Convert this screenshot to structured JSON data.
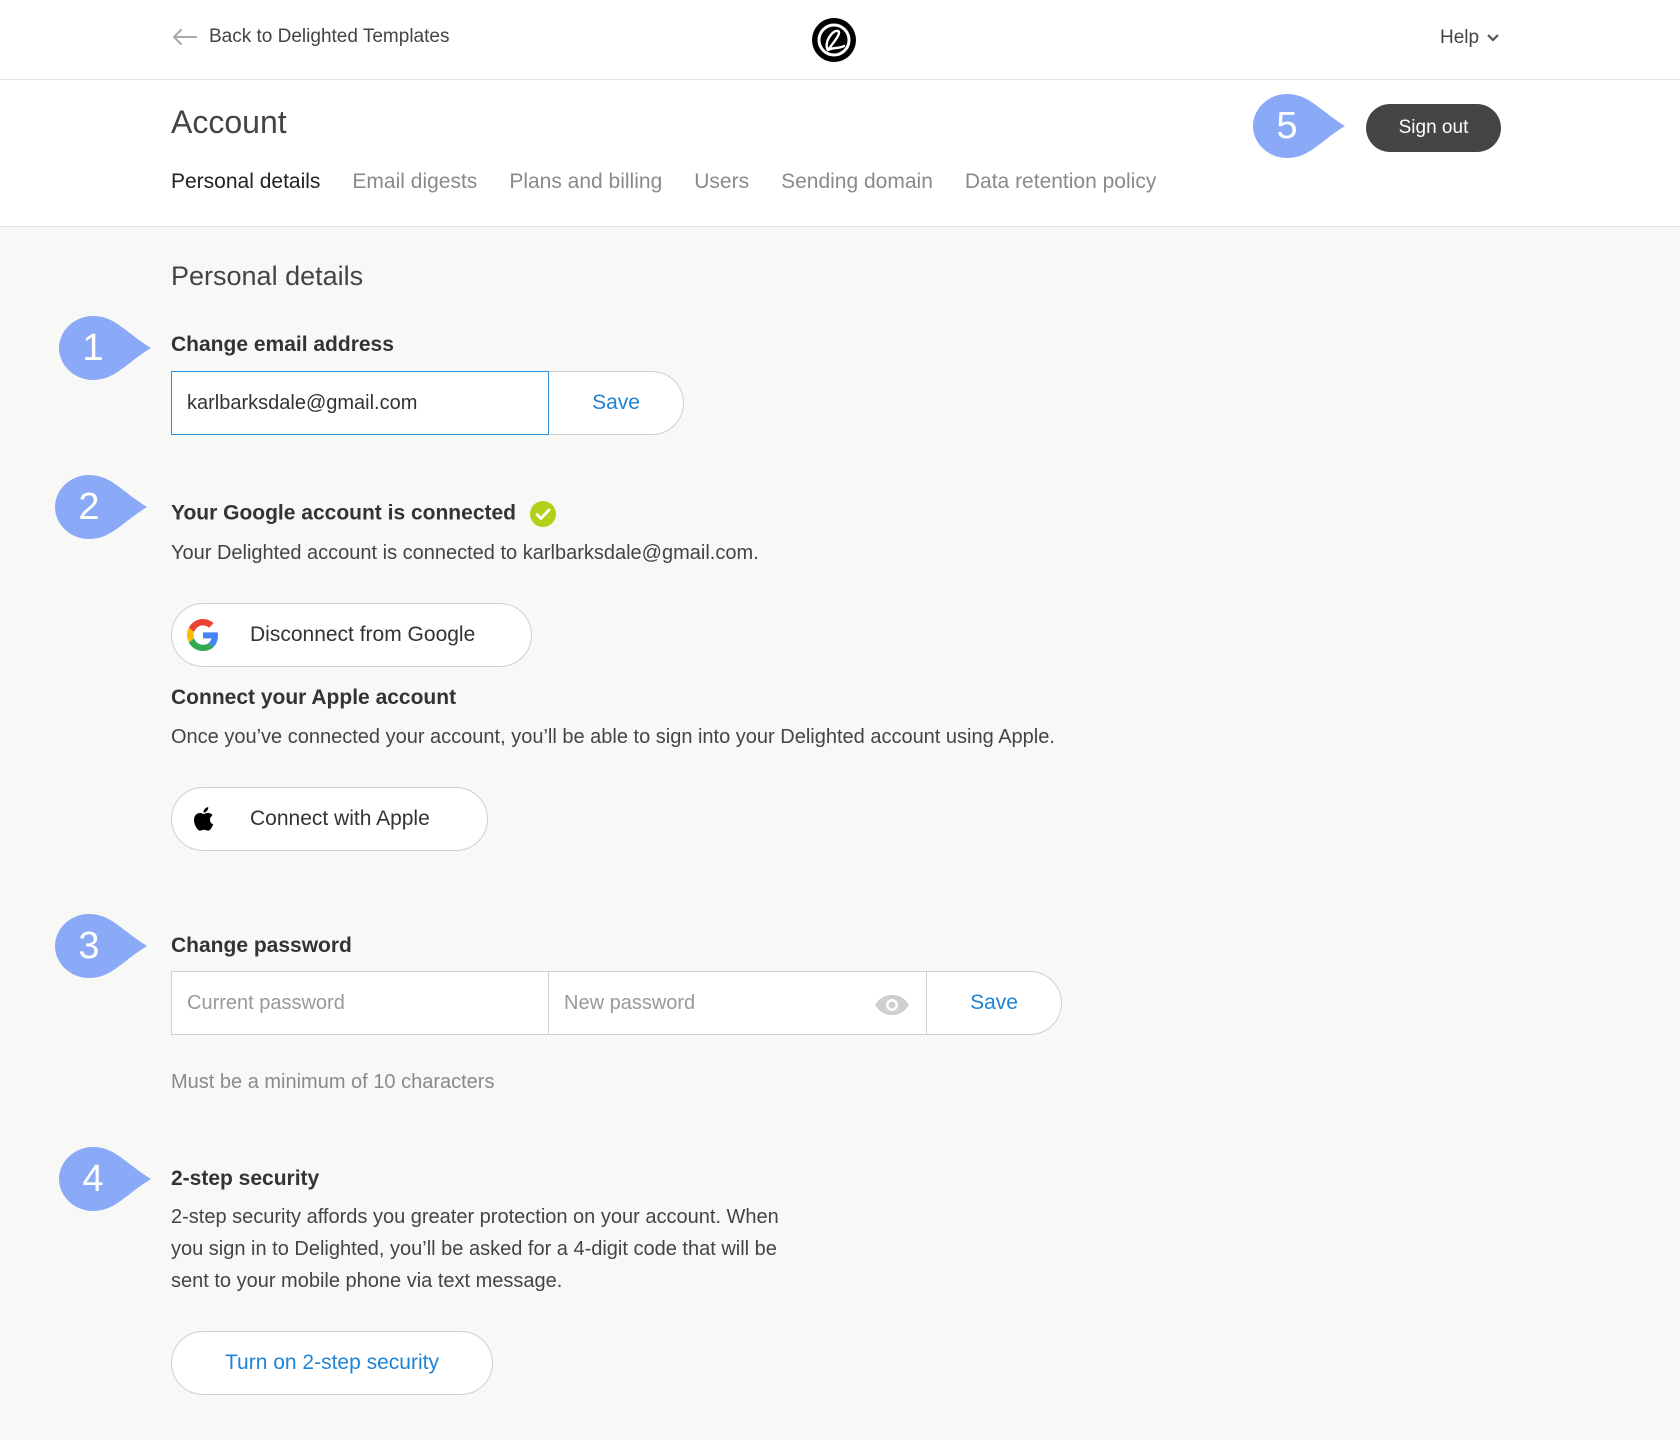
{
  "topbar": {
    "back_label": "Back to Delighted Templates",
    "help_label": "Help"
  },
  "account": {
    "title": "Account",
    "signout_label": "Sign out",
    "tabs": [
      {
        "label": "Personal details",
        "active": true
      },
      {
        "label": "Email digests",
        "active": false
      },
      {
        "label": "Plans and billing",
        "active": false
      },
      {
        "label": "Users",
        "active": false
      },
      {
        "label": "Sending domain",
        "active": false
      },
      {
        "label": "Data retention policy",
        "active": false
      }
    ]
  },
  "personal": {
    "section_title": "Personal details",
    "email": {
      "label": "Change email address",
      "value": "karlbarksdale@gmail.com",
      "save_label": "Save"
    },
    "google": {
      "label": "Your Google account is connected",
      "description": "Your Delighted account is connected to karlbarksdale@gmail.com.",
      "button_label": "Disconnect from Google"
    },
    "apple": {
      "label": "Connect your Apple account",
      "description": "Once you’ve connected your account, you’ll be able to sign into your Delighted account using Apple.",
      "button_label": "Connect with Apple"
    },
    "password": {
      "label": "Change password",
      "current_placeholder": "Current password",
      "new_placeholder": "New password",
      "save_label": "Save",
      "hint": "Must be a minimum of 10 characters"
    },
    "two_step": {
      "label": "2-step security",
      "description_lines": [
        "2-step security affords you greater protection on your account. When",
        "you sign in to Delighted, you’ll be asked for a 4-digit code that will be",
        "sent to your mobile phone via text message."
      ],
      "button_label": "Turn on 2-step security"
    }
  },
  "markers": [
    "1",
    "2",
    "3",
    "4",
    "5"
  ],
  "colors": {
    "marker": "#8aaaf7",
    "link_blue": "#1d83d8",
    "signout_bg": "#454545",
    "check_green": "#b3cf1a",
    "page_bg": "#f8f8f7"
  }
}
